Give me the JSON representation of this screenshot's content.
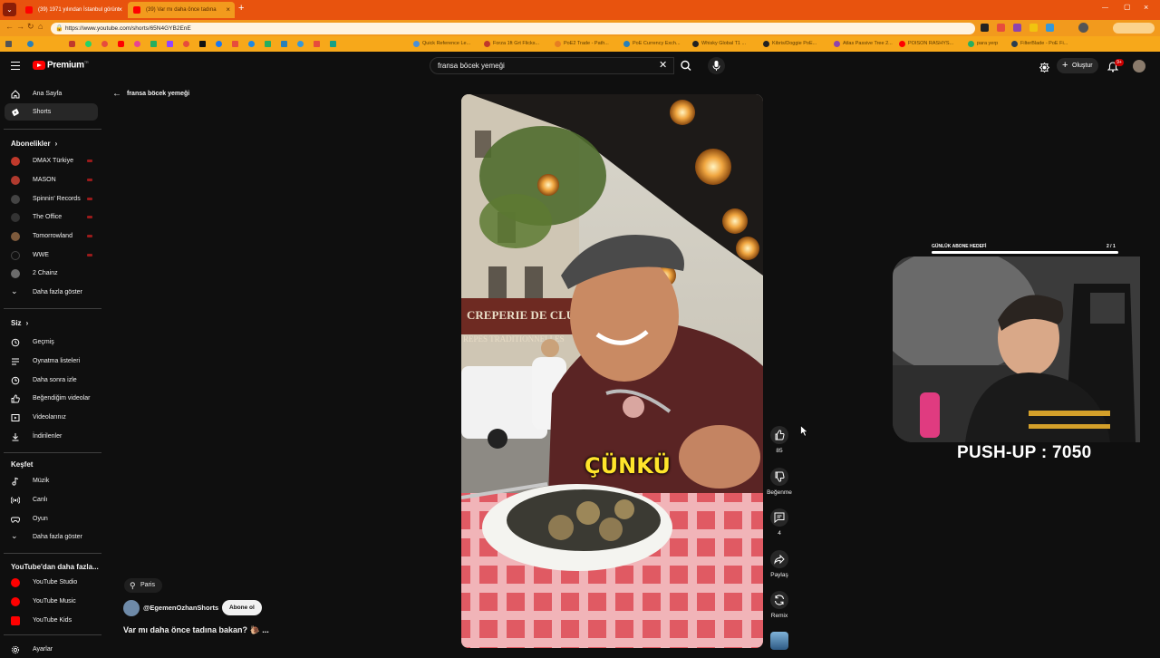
{
  "browser": {
    "tabs": [
      {
        "title": "(39) 1971 yılından İstanbul görünt",
        "active": false
      },
      {
        "title": "(39) Var mı daha önce tadına",
        "active": true
      }
    ],
    "url": "https://www.youtube.com/shorts/65N4GYB2EnE",
    "bookmarks": [
      {
        "label": "Quick Reference Le...",
        "color": "#4a90d9"
      },
      {
        "label": "Forza 1ft Grt Flicks...",
        "color": "#c0392b"
      },
      {
        "label": "PoE2 Trade - Path...",
        "color": "#e67e22"
      },
      {
        "label": "PoE Currency Exch...",
        "color": "#2980b9"
      },
      {
        "label": "Whisky Global T1 ...",
        "color": "#222222"
      },
      {
        "label": "Kibris/Doggie PoE...",
        "color": "#222222"
      },
      {
        "label": "Atlas Passive Tree 2...",
        "color": "#8e44ad"
      },
      {
        "label": "POISON RASHYS...",
        "color": "#ff0000"
      },
      {
        "label": "para yerp",
        "color": "#27ae60"
      },
      {
        "label": "FilterBlade - PoE Fi...",
        "color": "#2c3e50"
      }
    ]
  },
  "header": {
    "logo_text": "Premium",
    "logo_sup": "TR",
    "search_value": "fransa böcek yemeği",
    "create_label": "Oluştur",
    "notification_count": "9+"
  },
  "sidebar": {
    "main": [
      {
        "label": "Ana Sayfa",
        "icon": "home-icon"
      },
      {
        "label": "Shorts",
        "icon": "shorts-icon",
        "active": true
      }
    ],
    "subscriptions_title": "Abonelikler",
    "subscriptions": [
      {
        "label": "DMAX Türkiye",
        "color": "#c0392b"
      },
      {
        "label": "MASON",
        "color": "#b03a2e"
      },
      {
        "label": "Spinnin' Records",
        "color": "#444444"
      },
      {
        "label": "The Office",
        "color": "#333333"
      },
      {
        "label": "Tomorrowland",
        "color": "#7d5a3c"
      },
      {
        "label": "WWE",
        "color": "#111111"
      },
      {
        "label": "2 Chainz",
        "color": "#6b6b6b"
      }
    ],
    "show_more": "Daha fazla göster",
    "you_title": "Siz",
    "you": [
      {
        "label": "Geçmiş",
        "icon": "history-icon"
      },
      {
        "label": "Oynatma listeleri",
        "icon": "playlists-icon"
      },
      {
        "label": "Daha sonra izle",
        "icon": "watch-later-icon"
      },
      {
        "label": "Beğendiğim videolar",
        "icon": "liked-icon"
      },
      {
        "label": "Videolarınız",
        "icon": "your-videos-icon"
      },
      {
        "label": "İndirilenler",
        "icon": "downloads-icon"
      }
    ],
    "explore_title": "Keşfet",
    "explore": [
      {
        "label": "Müzik",
        "icon": "music-icon"
      },
      {
        "label": "Canlı",
        "icon": "live-icon"
      },
      {
        "label": "Oyun",
        "icon": "gaming-icon"
      }
    ],
    "explore_more": "Daha fazla göster",
    "more_title": "YouTube'dan daha fazla...",
    "more": [
      {
        "label": "YouTube Studio"
      },
      {
        "label": "YouTube Music"
      },
      {
        "label": "YouTube Kids"
      }
    ],
    "settings": "Ayarlar"
  },
  "back_link": "fransa böcek yemeği",
  "video": {
    "caption": "ÇÜNKÜ",
    "sign_text": "CREPERIE DE CLUNY",
    "sign_text2": "REPES TRADITIONNELLES"
  },
  "actions": {
    "likes": "85",
    "dislike_label": "Beğenme",
    "comments": "4",
    "share_label": "Paylaş",
    "remix_label": "Remix"
  },
  "channel": {
    "location": "Paris",
    "name": "@EgemenOzhanShorts",
    "subscribe_label": "Abone ol",
    "title": "Var mı daha önce tadına bakan? 🐌 ..."
  },
  "overlay": {
    "goal_label": "GÜNLÜK ABONE HEDEFİ",
    "goal_count": "2 / 1",
    "goal_progress": 1.0,
    "pushup_text": "PUSH-UP : 7050"
  }
}
